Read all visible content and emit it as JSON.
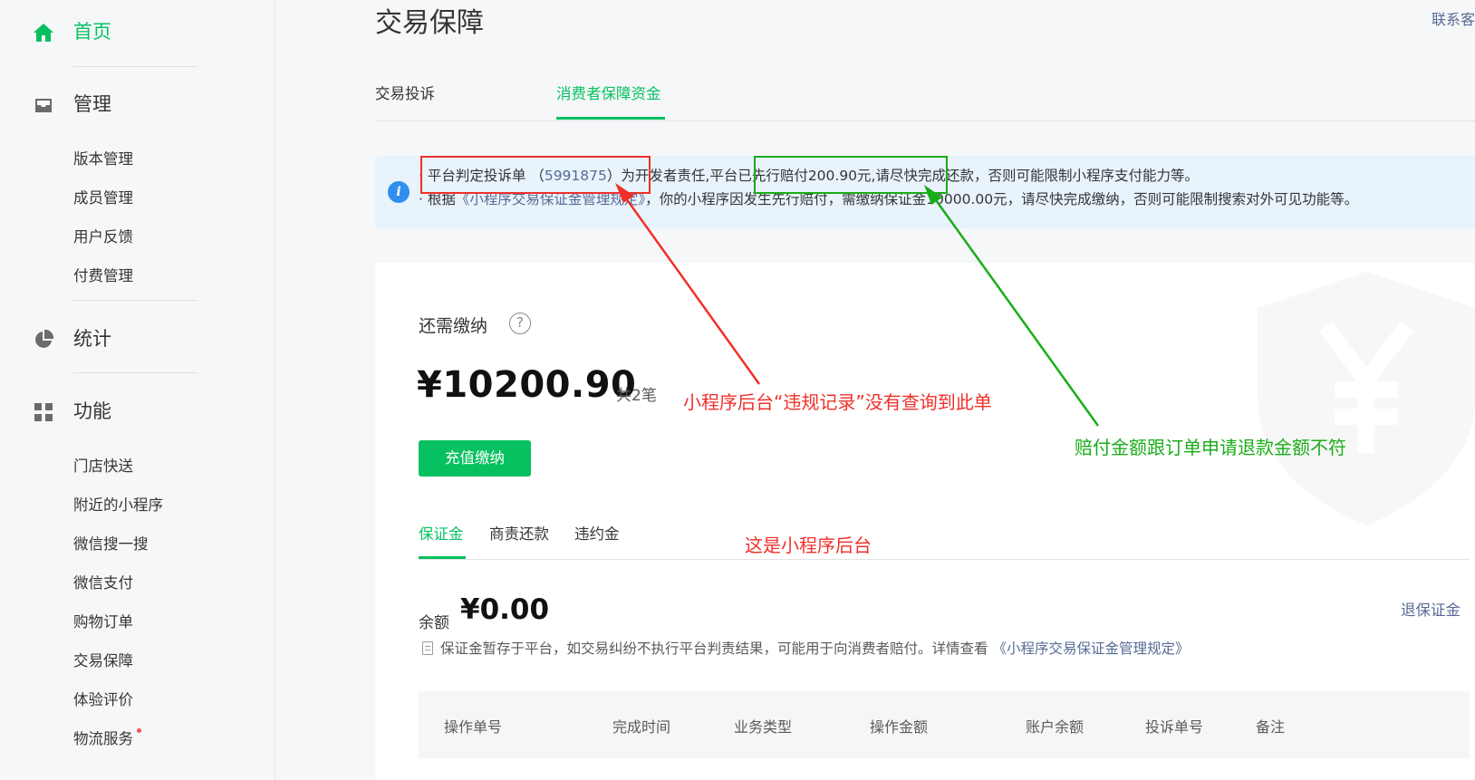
{
  "sidebar": {
    "home": "首页",
    "manage": "管理",
    "manage_items": [
      "版本管理",
      "成员管理",
      "用户反馈",
      "付费管理"
    ],
    "stats": "统计",
    "features": "功能",
    "feature_items": [
      "门店快送",
      "附近的小程序",
      "微信搜一搜",
      "微信支付",
      "购物订单",
      "交易保障",
      "体验评价",
      "物流服务"
    ]
  },
  "main": {
    "title": "交易保障",
    "contact": "联系客",
    "tabs": [
      "交易投诉",
      "消费者保障资金"
    ],
    "notice": {
      "line1_prefix": "平台判定投诉单",
      "line1_order_open": "（",
      "line1_order": "5991875",
      "line1_order_close": "）",
      "line1_mid": "为开发者责任,",
      "line1_paid": "平台已先行赔付200.90元,",
      "line1_suffix": "请尽快完成还款，否则可能限制小程序支付能力等。",
      "line2_prefix": "· 根据",
      "line2_link": "《小程序交易保证金管理规定》",
      "line2_suffix": "，你的小程序因发生先行赔付，需缴纳保证金10000.00元，请尽快完成缴纳，否则可能限制搜索对外可见功能等。"
    },
    "card": {
      "need_pay_label": "还需缴纳",
      "amount": "¥10200.90",
      "count": "共2笔",
      "recharge_button": "充值缴纳",
      "inner_tabs": [
        "保证金",
        "商责还款",
        "违约金"
      ],
      "balance_label": "余额",
      "balance_value": "¥0.00",
      "refund_link": "退保证金",
      "doc_note": "保证金暂存于平台，如交易纠纷不执行平台判责结果，可能用于向消费者赔付。详情查看",
      "doc_link": "《小程序交易保证金管理规定》",
      "table_headers": [
        "操作单号",
        "完成时间",
        "业务类型",
        "操作金额",
        "账户余额",
        "投诉单号",
        "备注"
      ]
    }
  },
  "annotations": {
    "red_text": "小程序后台“违规记录”没有查询到此单",
    "green_text": "赔付金额跟订单申请退款金额不符",
    "red_text2": "这是小程序后台",
    "red_color": "#f0302a",
    "green_color": "#1aad19"
  },
  "colors": {
    "accent": "#07c160",
    "link": "#576b95"
  }
}
